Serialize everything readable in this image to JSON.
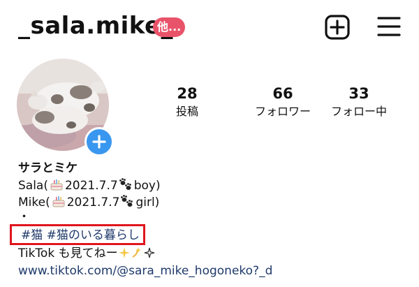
{
  "header": {
    "username": "_sala.mike_",
    "badge": "他..."
  },
  "stats": [
    {
      "count": "28",
      "label": "投稿"
    },
    {
      "count": "66",
      "label": "フォロワー"
    },
    {
      "count": "33",
      "label": "フォロー中"
    }
  ],
  "bio": {
    "name": "サラとミケ",
    "sala_prefix": "Sala(",
    "sala_date": "2021.7.7",
    "sala_suffix": "boy)",
    "mike_prefix": "Mike(",
    "mike_date": "2021.7.7",
    "mike_suffix": "girl)",
    "dot": "・",
    "hashtags": "#猫 #猫のいる暮らし",
    "tiktok_text": "TikTok も見てねー",
    "link": "www.tiktok.com/@sara_mike_hogoneko?_d"
  },
  "icons": {
    "new_post": "plus-square-icon",
    "menu": "hamburger-menu-icon",
    "add_story": "plus-circle-icon",
    "cake": "birthday-cake-emoji",
    "paw": "paw-prints-emoji",
    "sparkles": "sparkles-emoji",
    "dizzy": "dizzy-star-emoji"
  },
  "colors": {
    "badge": "#e9536a",
    "add_story": "#3a97f0",
    "link": "#1f3a6b",
    "highlight_box": "#e0151d"
  }
}
